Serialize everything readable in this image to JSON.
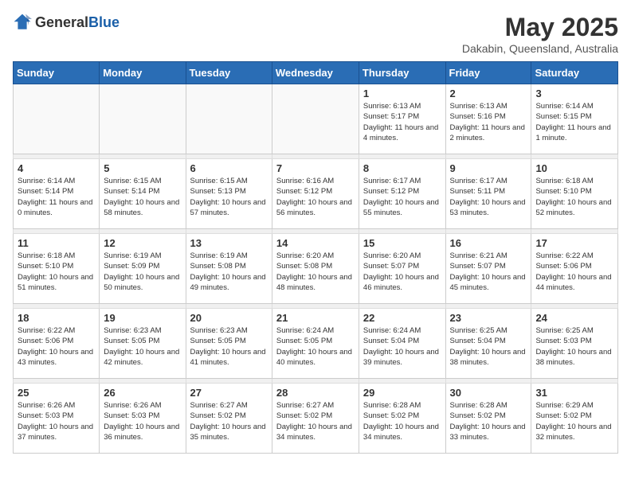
{
  "logo": {
    "general": "General",
    "blue": "Blue"
  },
  "header": {
    "month": "May 2025",
    "location": "Dakabin, Queensland, Australia"
  },
  "weekdays": [
    "Sunday",
    "Monday",
    "Tuesday",
    "Wednesday",
    "Thursday",
    "Friday",
    "Saturday"
  ],
  "weeks": [
    [
      {
        "day": "",
        "sunrise": "",
        "sunset": "",
        "daylight": ""
      },
      {
        "day": "",
        "sunrise": "",
        "sunset": "",
        "daylight": ""
      },
      {
        "day": "",
        "sunrise": "",
        "sunset": "",
        "daylight": ""
      },
      {
        "day": "",
        "sunrise": "",
        "sunset": "",
        "daylight": ""
      },
      {
        "day": "1",
        "sunrise": "Sunrise: 6:13 AM",
        "sunset": "Sunset: 5:17 PM",
        "daylight": "Daylight: 11 hours and 4 minutes."
      },
      {
        "day": "2",
        "sunrise": "Sunrise: 6:13 AM",
        "sunset": "Sunset: 5:16 PM",
        "daylight": "Daylight: 11 hours and 2 minutes."
      },
      {
        "day": "3",
        "sunrise": "Sunrise: 6:14 AM",
        "sunset": "Sunset: 5:15 PM",
        "daylight": "Daylight: 11 hours and 1 minute."
      }
    ],
    [
      {
        "day": "4",
        "sunrise": "Sunrise: 6:14 AM",
        "sunset": "Sunset: 5:14 PM",
        "daylight": "Daylight: 11 hours and 0 minutes."
      },
      {
        "day": "5",
        "sunrise": "Sunrise: 6:15 AM",
        "sunset": "Sunset: 5:14 PM",
        "daylight": "Daylight: 10 hours and 58 minutes."
      },
      {
        "day": "6",
        "sunrise": "Sunrise: 6:15 AM",
        "sunset": "Sunset: 5:13 PM",
        "daylight": "Daylight: 10 hours and 57 minutes."
      },
      {
        "day": "7",
        "sunrise": "Sunrise: 6:16 AM",
        "sunset": "Sunset: 5:12 PM",
        "daylight": "Daylight: 10 hours and 56 minutes."
      },
      {
        "day": "8",
        "sunrise": "Sunrise: 6:17 AM",
        "sunset": "Sunset: 5:12 PM",
        "daylight": "Daylight: 10 hours and 55 minutes."
      },
      {
        "day": "9",
        "sunrise": "Sunrise: 6:17 AM",
        "sunset": "Sunset: 5:11 PM",
        "daylight": "Daylight: 10 hours and 53 minutes."
      },
      {
        "day": "10",
        "sunrise": "Sunrise: 6:18 AM",
        "sunset": "Sunset: 5:10 PM",
        "daylight": "Daylight: 10 hours and 52 minutes."
      }
    ],
    [
      {
        "day": "11",
        "sunrise": "Sunrise: 6:18 AM",
        "sunset": "Sunset: 5:10 PM",
        "daylight": "Daylight: 10 hours and 51 minutes."
      },
      {
        "day": "12",
        "sunrise": "Sunrise: 6:19 AM",
        "sunset": "Sunset: 5:09 PM",
        "daylight": "Daylight: 10 hours and 50 minutes."
      },
      {
        "day": "13",
        "sunrise": "Sunrise: 6:19 AM",
        "sunset": "Sunset: 5:08 PM",
        "daylight": "Daylight: 10 hours and 49 minutes."
      },
      {
        "day": "14",
        "sunrise": "Sunrise: 6:20 AM",
        "sunset": "Sunset: 5:08 PM",
        "daylight": "Daylight: 10 hours and 48 minutes."
      },
      {
        "day": "15",
        "sunrise": "Sunrise: 6:20 AM",
        "sunset": "Sunset: 5:07 PM",
        "daylight": "Daylight: 10 hours and 46 minutes."
      },
      {
        "day": "16",
        "sunrise": "Sunrise: 6:21 AM",
        "sunset": "Sunset: 5:07 PM",
        "daylight": "Daylight: 10 hours and 45 minutes."
      },
      {
        "day": "17",
        "sunrise": "Sunrise: 6:22 AM",
        "sunset": "Sunset: 5:06 PM",
        "daylight": "Daylight: 10 hours and 44 minutes."
      }
    ],
    [
      {
        "day": "18",
        "sunrise": "Sunrise: 6:22 AM",
        "sunset": "Sunset: 5:06 PM",
        "daylight": "Daylight: 10 hours and 43 minutes."
      },
      {
        "day": "19",
        "sunrise": "Sunrise: 6:23 AM",
        "sunset": "Sunset: 5:05 PM",
        "daylight": "Daylight: 10 hours and 42 minutes."
      },
      {
        "day": "20",
        "sunrise": "Sunrise: 6:23 AM",
        "sunset": "Sunset: 5:05 PM",
        "daylight": "Daylight: 10 hours and 41 minutes."
      },
      {
        "day": "21",
        "sunrise": "Sunrise: 6:24 AM",
        "sunset": "Sunset: 5:05 PM",
        "daylight": "Daylight: 10 hours and 40 minutes."
      },
      {
        "day": "22",
        "sunrise": "Sunrise: 6:24 AM",
        "sunset": "Sunset: 5:04 PM",
        "daylight": "Daylight: 10 hours and 39 minutes."
      },
      {
        "day": "23",
        "sunrise": "Sunrise: 6:25 AM",
        "sunset": "Sunset: 5:04 PM",
        "daylight": "Daylight: 10 hours and 38 minutes."
      },
      {
        "day": "24",
        "sunrise": "Sunrise: 6:25 AM",
        "sunset": "Sunset: 5:03 PM",
        "daylight": "Daylight: 10 hours and 38 minutes."
      }
    ],
    [
      {
        "day": "25",
        "sunrise": "Sunrise: 6:26 AM",
        "sunset": "Sunset: 5:03 PM",
        "daylight": "Daylight: 10 hours and 37 minutes."
      },
      {
        "day": "26",
        "sunrise": "Sunrise: 6:26 AM",
        "sunset": "Sunset: 5:03 PM",
        "daylight": "Daylight: 10 hours and 36 minutes."
      },
      {
        "day": "27",
        "sunrise": "Sunrise: 6:27 AM",
        "sunset": "Sunset: 5:02 PM",
        "daylight": "Daylight: 10 hours and 35 minutes."
      },
      {
        "day": "28",
        "sunrise": "Sunrise: 6:27 AM",
        "sunset": "Sunset: 5:02 PM",
        "daylight": "Daylight: 10 hours and 34 minutes."
      },
      {
        "day": "29",
        "sunrise": "Sunrise: 6:28 AM",
        "sunset": "Sunset: 5:02 PM",
        "daylight": "Daylight: 10 hours and 34 minutes."
      },
      {
        "day": "30",
        "sunrise": "Sunrise: 6:28 AM",
        "sunset": "Sunset: 5:02 PM",
        "daylight": "Daylight: 10 hours and 33 minutes."
      },
      {
        "day": "31",
        "sunrise": "Sunrise: 6:29 AM",
        "sunset": "Sunset: 5:02 PM",
        "daylight": "Daylight: 10 hours and 32 minutes."
      }
    ]
  ]
}
